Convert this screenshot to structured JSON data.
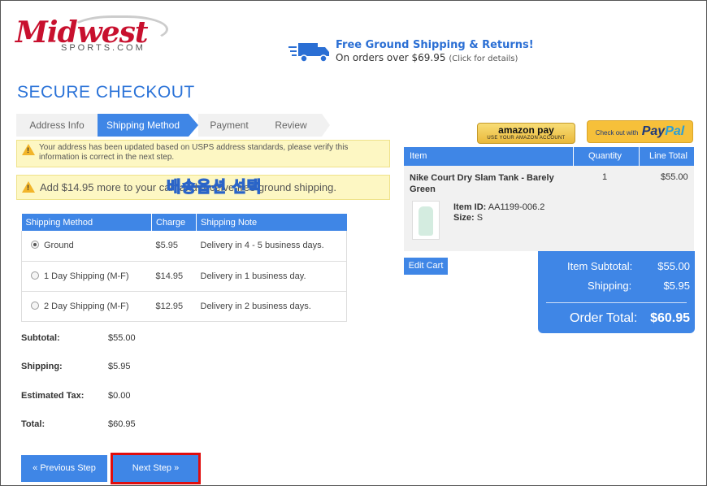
{
  "header": {
    "logo_main": "Midwest",
    "logo_sub": "SPORTS.COM",
    "promo_title": "Free Ground Shipping & Returns!",
    "promo_sub": "On orders over $69.95",
    "promo_details": "(Click for details)"
  },
  "page_title": "SECURE CHECKOUT",
  "steps": [
    {
      "label": "Address Info",
      "active": false
    },
    {
      "label": "Shipping Method",
      "active": true
    },
    {
      "label": "Payment",
      "active": false
    },
    {
      "label": "Review",
      "active": false
    }
  ],
  "alerts": {
    "usps": "Your address has been updated based on USPS address standards, please verify this information is correct in the next step.",
    "free_shipping": "Add $14.95 more to your cart and receive free ground shipping."
  },
  "overlay_caption": "배송옵션 선택",
  "shipping_table": {
    "headers": [
      "Shipping Method",
      "Charge",
      "Shipping Note"
    ],
    "rows": [
      {
        "method": "Ground",
        "charge": "$5.95",
        "note": "Delivery in 4 - 5 business days.",
        "selected": true
      },
      {
        "method": "1 Day Shipping (M-F)",
        "charge": "$14.95",
        "note": "Delivery in 1 business day.",
        "selected": false
      },
      {
        "method": "2 Day Shipping (M-F)",
        "charge": "$12.95",
        "note": "Delivery in 2 business days.",
        "selected": false
      }
    ]
  },
  "summary": {
    "subtotal_label": "Subtotal:",
    "subtotal": "$55.00",
    "shipping_label": "Shipping:",
    "shipping": "$5.95",
    "tax_label": "Estimated Tax:",
    "tax": "$0.00",
    "total_label": "Total:",
    "total": "$60.95"
  },
  "buttons": {
    "previous": "« Previous Step",
    "next": "Next Step »",
    "edit_cart": "Edit Cart"
  },
  "payments": {
    "amazon_line1": "amazon pay",
    "amazon_line2": "USE YOUR AMAZON ACCOUNT",
    "paypal_prefix": "Check out with",
    "paypal_pay": "Pay",
    "paypal_pal": "Pal"
  },
  "cart": {
    "headers": {
      "item": "Item",
      "quantity": "Quantity",
      "line_total": "Line Total"
    },
    "item_name": "Nike Court Dry Slam Tank - Barely Green",
    "item_id_label": "Item ID:",
    "item_id": "AA1199-006.2",
    "size_label": "Size:",
    "size": "S",
    "quantity": "1",
    "line_total": "$55.00"
  },
  "totals": {
    "subtotal_label": "Item Subtotal:",
    "subtotal": "$55.00",
    "shipping_label": "Shipping:",
    "shipping": "$5.95",
    "order_total_label": "Order Total:",
    "order_total": "$60.95"
  },
  "colors": {
    "accent": "#3f86e6",
    "brand": "#c8102e",
    "highlight": "#e00d0d",
    "warning_bg": "#fdf7c3"
  }
}
